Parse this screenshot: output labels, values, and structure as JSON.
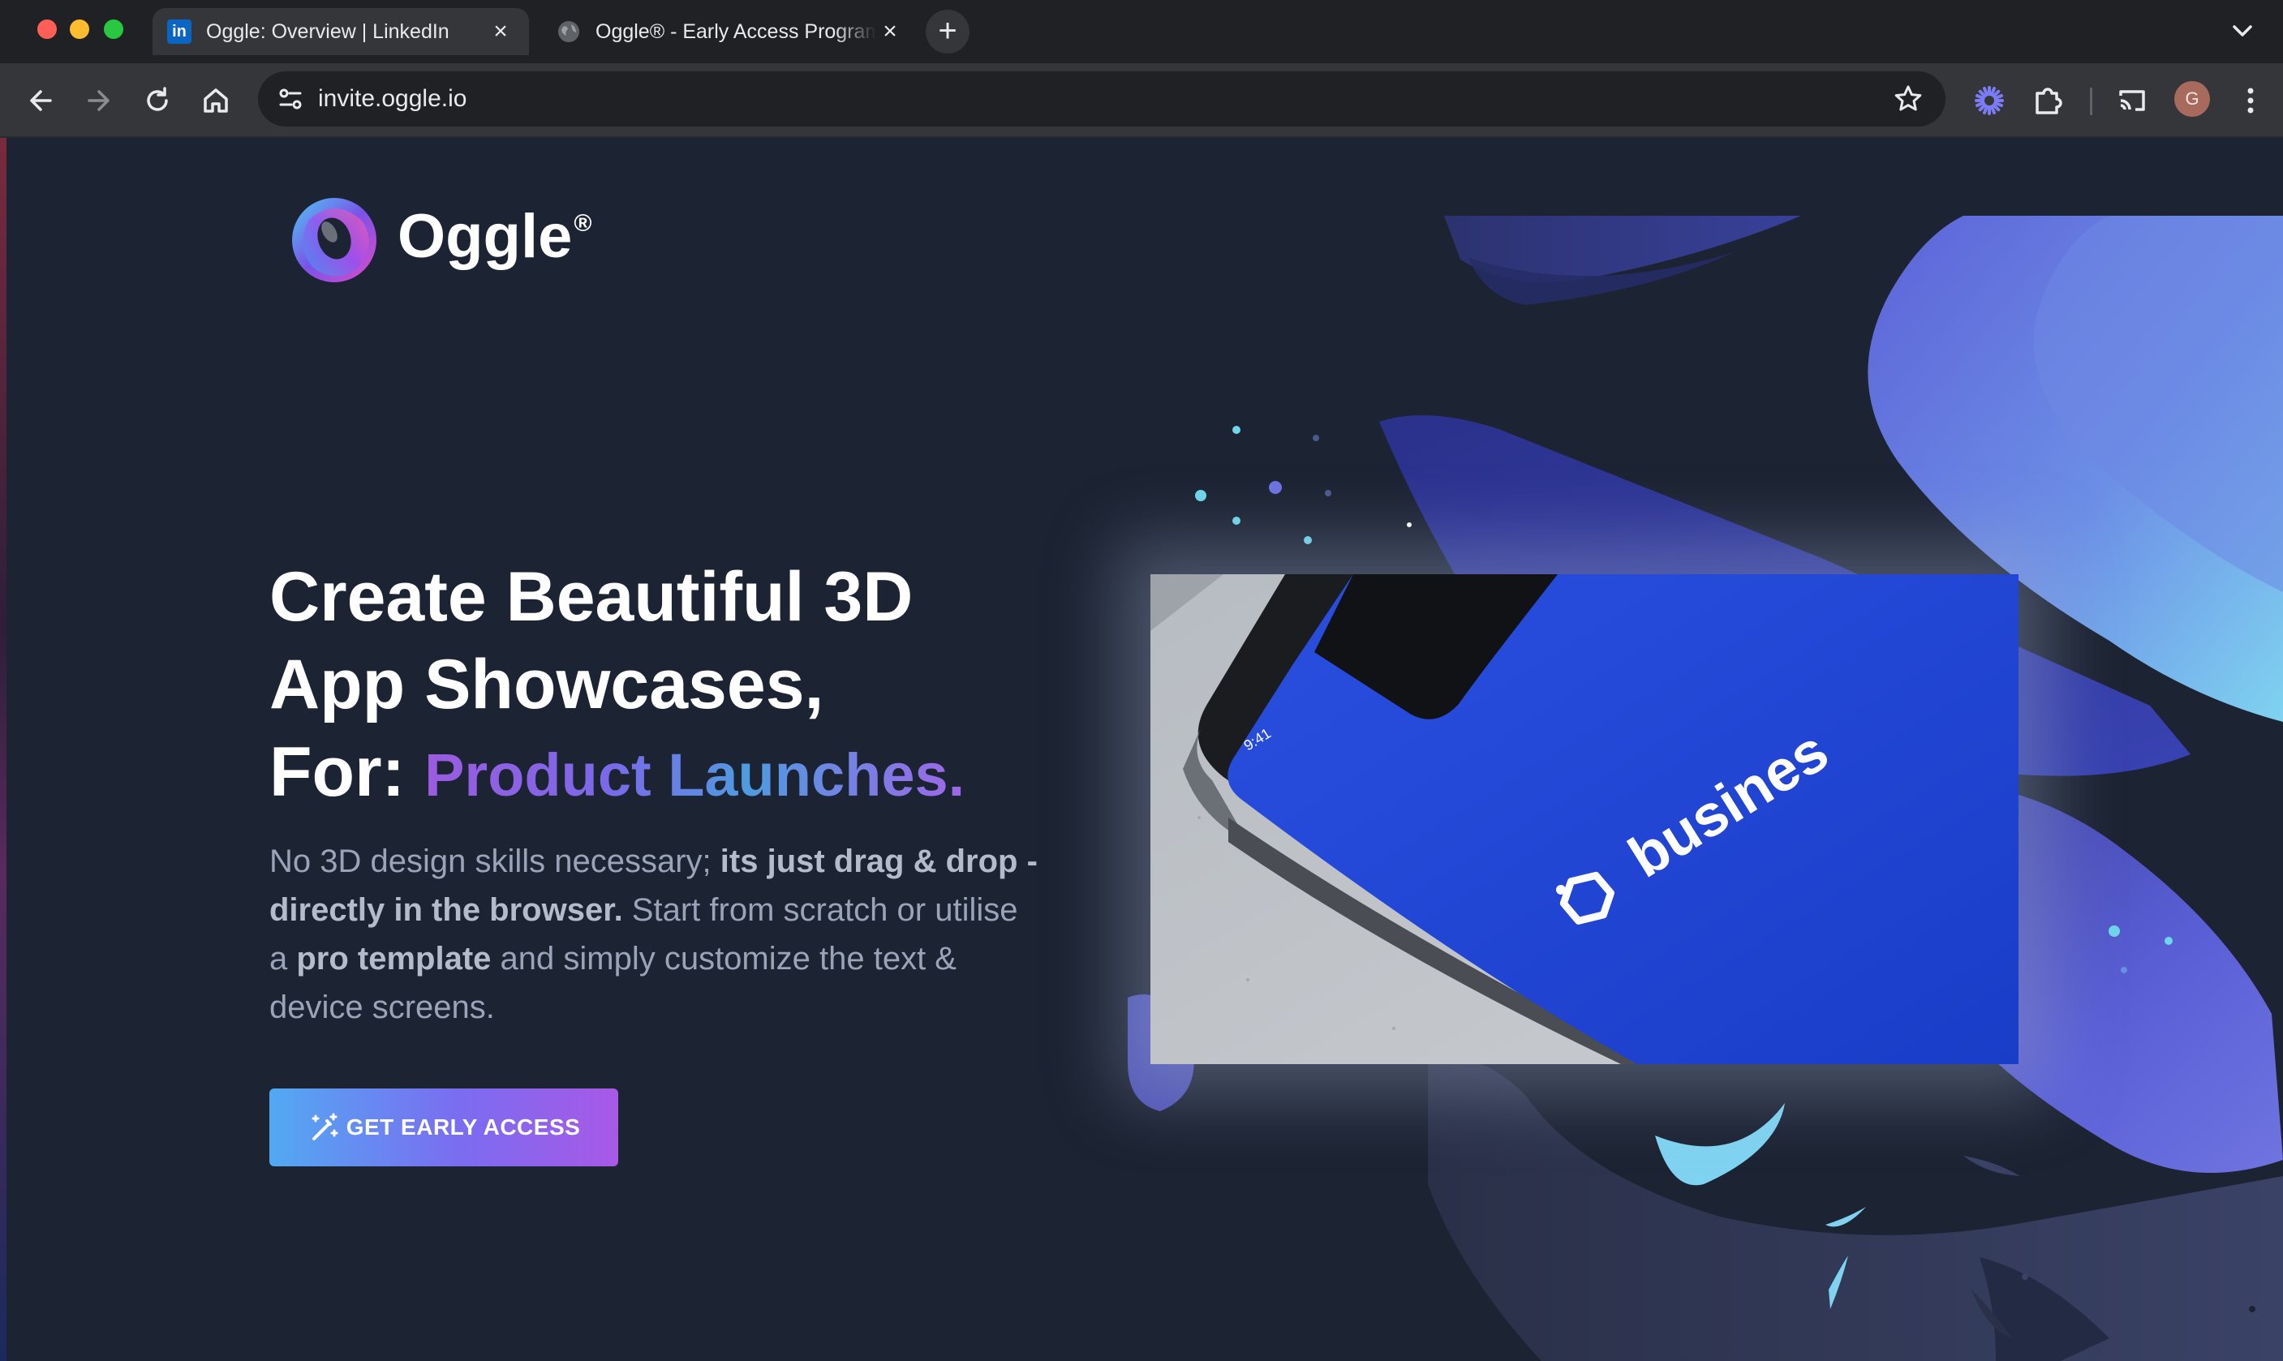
{
  "browser": {
    "tabs": [
      {
        "title": "Oggle: Overview | LinkedIn",
        "favicon": "linkedin-icon",
        "active": true
      },
      {
        "title": "Oggle® - Early Access Program",
        "favicon": "globe-icon",
        "active": false
      }
    ],
    "linkedin_favicon_text": "in",
    "url": "invite.oggle.io",
    "profile_initial": "G"
  },
  "page": {
    "brand_name": "Oggle",
    "brand_mark": "®",
    "headline": {
      "line1": "Create Beautiful 3D",
      "line2": "App Showcases,",
      "line3_prefix": "For: ",
      "line3_highlight": "Product Launches."
    },
    "subtext": {
      "p1": "No 3D design skills necessary; ",
      "b1": "its just drag & drop - directly in the browser.",
      "p2": " Start from scratch or utilise a ",
      "b2": "pro template",
      "p3": " and simply customize the text & device screens."
    },
    "cta_label": "GET EARLY ACCESS",
    "phone": {
      "status_time": "9:41",
      "app_name": "busines"
    }
  },
  "colors": {
    "page_background": "#1c2333",
    "cta_gradient": [
      "#52a9f2",
      "#7b6cf0",
      "#a859e6"
    ],
    "phone_screen": "#1f45d6",
    "blob_purple": "#5a5fd6",
    "blob_cyan": "#7fd3f0"
  }
}
